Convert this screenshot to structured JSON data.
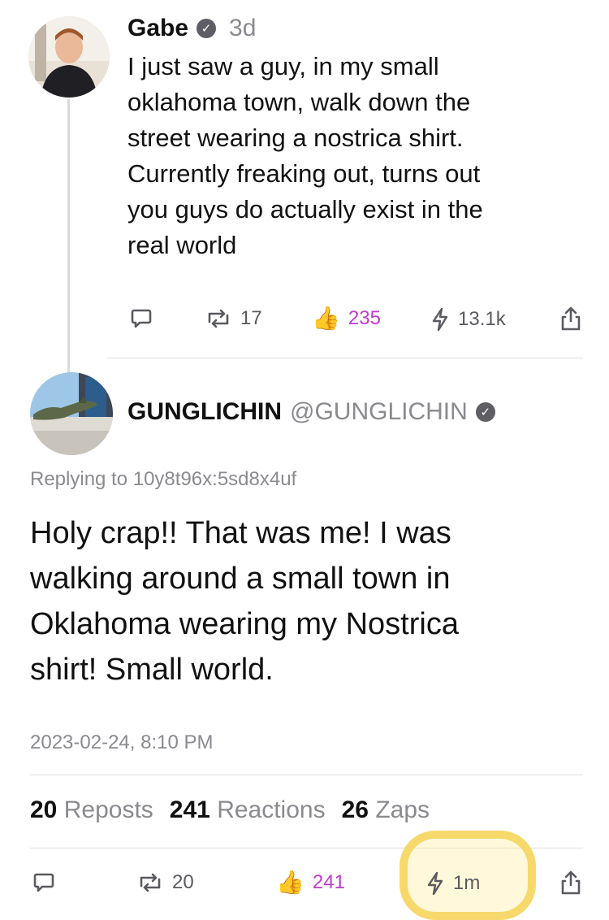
{
  "post1": {
    "author": "Gabe",
    "time": "3d",
    "text_lines": [
      "I just saw a guy, in my small",
      "oklahoma town, walk down the",
      "street wearing a nostrica shirt.",
      "Currently freaking out, turns out",
      "you guys do actually exist in the",
      "real world"
    ],
    "actions": {
      "reposts": "17",
      "reactions": "235",
      "zaps": "13.1k"
    }
  },
  "post2": {
    "author": "GUNGLICHIN",
    "handle": "@GUNGLICHIN",
    "replying_to": "Replying to 10y8t96x:5sd8x4uf",
    "text_lines": [
      "Holy crap!! That was me! I was",
      "walking around a small town in",
      "Oklahoma wearing my Nostrica",
      "shirt! Small world."
    ],
    "timestamp": "2023-02-24, 8:10 PM",
    "stats": {
      "reposts_count": "20",
      "reposts_label": "Reposts",
      "reactions_count": "241",
      "reactions_label": "Reactions",
      "zaps_count": "26",
      "zaps_label": "Zaps"
    },
    "actions": {
      "reposts": "20",
      "reactions": "241",
      "zaps": "1m"
    }
  },
  "colors": {
    "reaction_accent": "#c33ad1",
    "highlight": "#f7d86a",
    "muted_text": "#8a8a8f"
  }
}
